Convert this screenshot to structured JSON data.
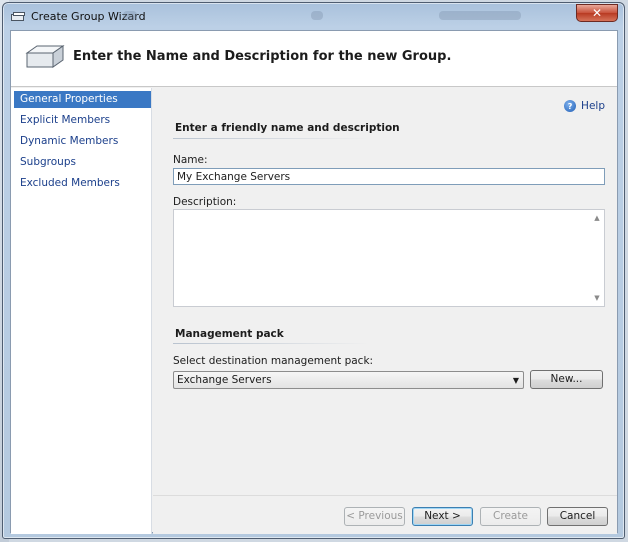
{
  "window": {
    "title": "Create Group Wizard",
    "close_label": "✕"
  },
  "header": {
    "title": "Enter the Name and Description for the new Group."
  },
  "nav": {
    "items": [
      {
        "label": "General Properties",
        "active": true
      },
      {
        "label": "Explicit Members",
        "active": false
      },
      {
        "label": "Dynamic Members",
        "active": false
      },
      {
        "label": "Subgroups",
        "active": false
      },
      {
        "label": "Excluded Members",
        "active": false
      }
    ]
  },
  "main": {
    "help_label": "Help",
    "help_icon": "help-icon",
    "section1_title": "Enter a friendly name and description",
    "name_label": "Name:",
    "name_value": "My Exchange Servers",
    "description_label": "Description:",
    "description_value": "",
    "section2_title": "Management pack",
    "mp_label": "Select destination management pack:",
    "mp_selected": "Exchange Servers",
    "new_button": "New..."
  },
  "footer": {
    "previous": "< Previous",
    "next": "Next >",
    "create": "Create",
    "cancel": "Cancel"
  },
  "colors": {
    "nav_active": "#3a78c4",
    "link": "#1b3f8b"
  }
}
